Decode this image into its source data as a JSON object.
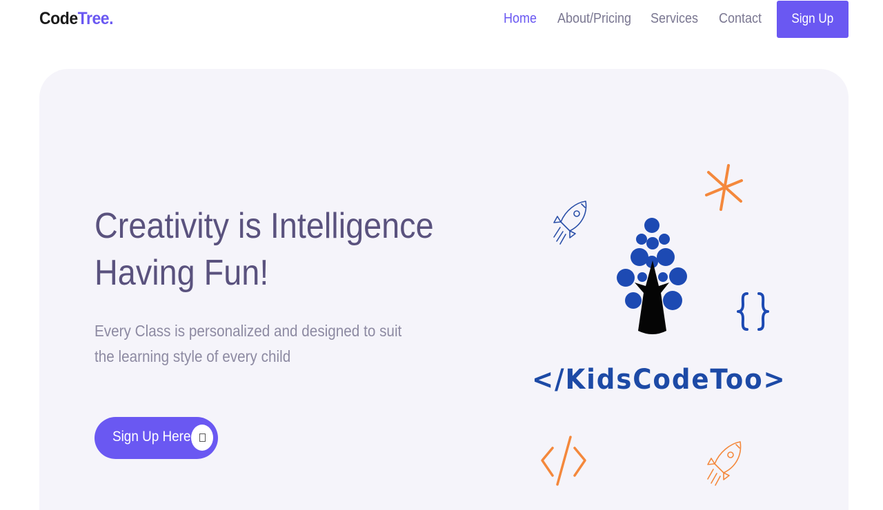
{
  "brand": {
    "name_part1": "Code",
    "name_part2": "Tree",
    "name_dot": "."
  },
  "nav": {
    "items": [
      {
        "label": "Home",
        "active": true
      },
      {
        "label": "About/Pricing",
        "active": false
      },
      {
        "label": "Services",
        "active": false
      },
      {
        "label": "Contact",
        "active": false
      }
    ],
    "signup_label": "Sign Up"
  },
  "hero": {
    "title_line1": "Creativity is Intelligence",
    "title_line2": "Having Fun!",
    "subtitle": "Every Class is personalized and designed to suit the learning style of every child",
    "cta_label": "Sign Up Here",
    "cta_icon": "arrow-icon"
  },
  "illustration": {
    "brand_text": "</KidsCodeToo>",
    "icons": [
      "rocket-icon",
      "asterisk-icon",
      "tree-logo-icon",
      "curly-braces-icon",
      "code-tag-icon",
      "rocket-icon"
    ]
  },
  "colors": {
    "accent": "#6a58f2",
    "title": "#5a527e",
    "subtitle": "#8d8aa2",
    "nav_text": "#7a7791",
    "hero_bg": "#f5f4fa",
    "logo_blue": "#1d4aa6",
    "orange": "#f4883c"
  }
}
